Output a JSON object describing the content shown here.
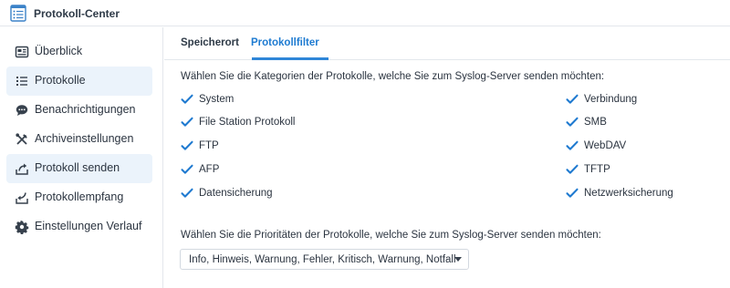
{
  "window": {
    "title": "Protokoll-Center",
    "icon": "log-center-icon"
  },
  "sidebar": {
    "items": [
      {
        "label": "Überblick",
        "icon": "overview-card-icon",
        "active": false
      },
      {
        "label": "Protokolle",
        "icon": "list-icon",
        "active": true
      },
      {
        "label": "Benachrichtigungen",
        "icon": "chat-bubble-icon",
        "active": false
      },
      {
        "label": "Archiveinstellungen",
        "icon": "tools-icon",
        "active": false
      },
      {
        "label": "Protokoll senden",
        "icon": "send-icon",
        "active": true
      },
      {
        "label": "Protokollempfang",
        "icon": "receive-icon",
        "active": false
      },
      {
        "label": "Einstellungen Verlauf",
        "icon": "gear-icon",
        "active": false
      }
    ]
  },
  "tabs": [
    {
      "label": "Speicherort",
      "active": false
    },
    {
      "label": "Protokollfilter",
      "active": true
    }
  ],
  "categories": {
    "heading": "Wählen Sie die Kategorien der Protokolle, welche Sie zum Syslog-Server senden möchten:",
    "left": [
      {
        "label": "System",
        "checked": true
      },
      {
        "label": "File Station Protokoll",
        "checked": true
      },
      {
        "label": "FTP",
        "checked": true
      },
      {
        "label": "AFP",
        "checked": true
      },
      {
        "label": "Datensicherung",
        "checked": true
      }
    ],
    "right": [
      {
        "label": "Verbindung",
        "checked": true
      },
      {
        "label": "SMB",
        "checked": true
      },
      {
        "label": "WebDAV",
        "checked": true
      },
      {
        "label": "TFTP",
        "checked": true
      },
      {
        "label": "Netzwerksicherung",
        "checked": true
      }
    ]
  },
  "priorities": {
    "heading": "Wählen Sie die Prioritäten der Protokolle, welche Sie zum Syslog-Server senden möchten:",
    "selected": "Info, Hinweis, Warnung, Fehler, Kritisch, Warnung, Notfall",
    "caret_icon": "caret-down-icon"
  },
  "colors": {
    "accent": "#1e7bd1",
    "active_nav_bg": "#ebf3fb",
    "check": "#1f7ad0",
    "text": "#2b3440",
    "border": "#e3e7ec"
  }
}
